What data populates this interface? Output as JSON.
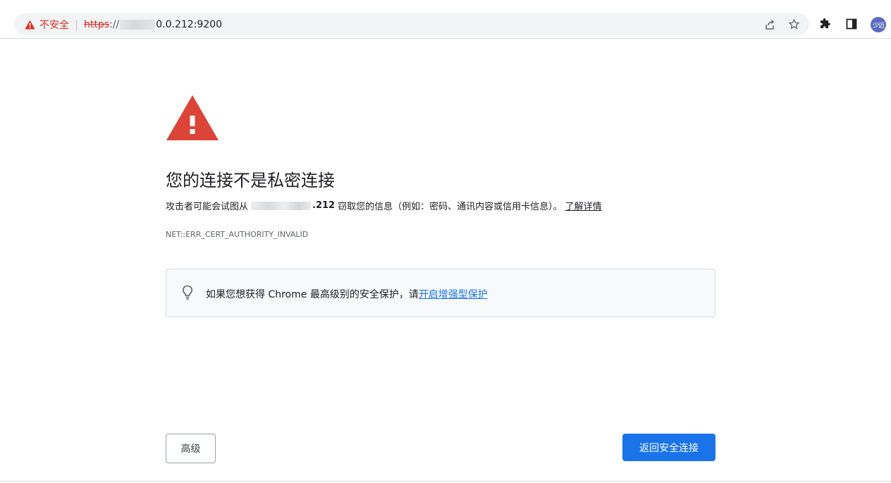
{
  "address_bar": {
    "security_label": "不安全",
    "separator": "|",
    "scheme": "https",
    "scheme_suffix": "://",
    "host_visible": "0.0.212:9200"
  },
  "toolbar": {
    "icons": [
      "share-icon",
      "bookmark-star-icon",
      "extensions-icon",
      "side-panel-icon"
    ],
    "profile_avatar_text": "少迈"
  },
  "interstitial": {
    "title": "您的连接不是私密连接",
    "description_prefix": "攻击者可能会试图从",
    "description_ip_suffix": ".212",
    "description_rest": "窃取您的信息（例如：密码、通讯内容或信用卡信息）。",
    "learn_more_link": "了解详情",
    "error_code": "NET::ERR_CERT_AUTHORITY_INVALID",
    "enhanced_protection": {
      "text": "如果您想获得 Chrome 最高级别的安全保护，请",
      "link": "开启增强型保护"
    },
    "advanced_button": "高级",
    "back_to_safety_button": "返回安全连接"
  },
  "colors": {
    "danger_red": "#d93025",
    "warning_icon_red": "#db4437",
    "primary_blue": "#1a73e8",
    "avatar_bg": "#5c6bc0"
  }
}
